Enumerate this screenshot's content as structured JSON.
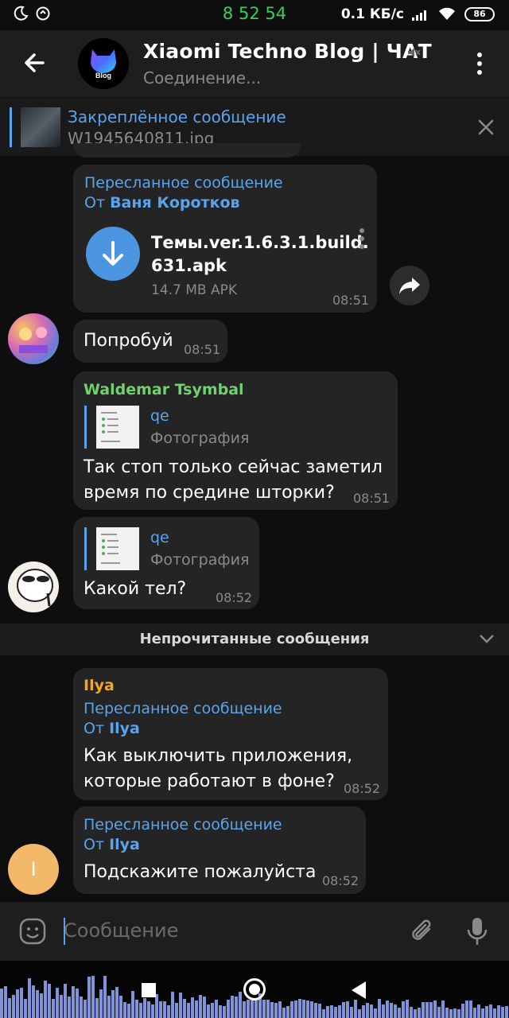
{
  "status_bar": {
    "time": "8 52 54",
    "net_speed": "0.1 КБ/с",
    "battery": "86"
  },
  "header": {
    "avatar_text": "Blog",
    "title": "Xiaomi Techno Blog | ЧАТ",
    "status": "Соединение..."
  },
  "pinned": {
    "title": "Закреплённое сообщение",
    "file": "W1945640811.jpg"
  },
  "messages": [
    {
      "forward_label": "Пересланное сообщение",
      "from_prefix": "От",
      "from": "Ваня Коротков",
      "file_name_line1": "Темы.ver.1.6.3.1.build.",
      "file_name_line2": "631.apk",
      "file_meta": "14.7 MB APK",
      "time": "08:51"
    },
    {
      "text": "Попробуй",
      "time": "08:51"
    },
    {
      "sender": "Waldemar Tsymbal",
      "reply_name": "qe",
      "reply_sub": "Фотография",
      "text_line1": "Так стоп только сейчас заметил",
      "text_line2": "время по средине шторки?",
      "time": "08:51"
    },
    {
      "reply_name": "qe",
      "reply_sub": "Фотография",
      "text": "Какой тел?",
      "time": "08:52"
    },
    {
      "sender": "Ilya",
      "forward_label": "Пересланное сообщение",
      "from_prefix": "От",
      "from": "Ilya",
      "text_line1": "Как выключить приложения,",
      "text_line2": "которые работают в фоне?",
      "time": "08:52"
    },
    {
      "forward_label": "Пересланное сообщение",
      "from_prefix": "От",
      "from": "Ilya",
      "text": "Подскажите пожалуйста",
      "time": "08:52",
      "avatar_letter": "I"
    }
  ],
  "unread_label": "Непрочитанные сообщения",
  "input": {
    "placeholder": "Сообщение"
  },
  "colors": {
    "accent": "#5aa4ee",
    "bubble": "#242424",
    "background": "#0e0e0e",
    "green_name": "#6ed36e",
    "orange_name": "#f5a623"
  }
}
